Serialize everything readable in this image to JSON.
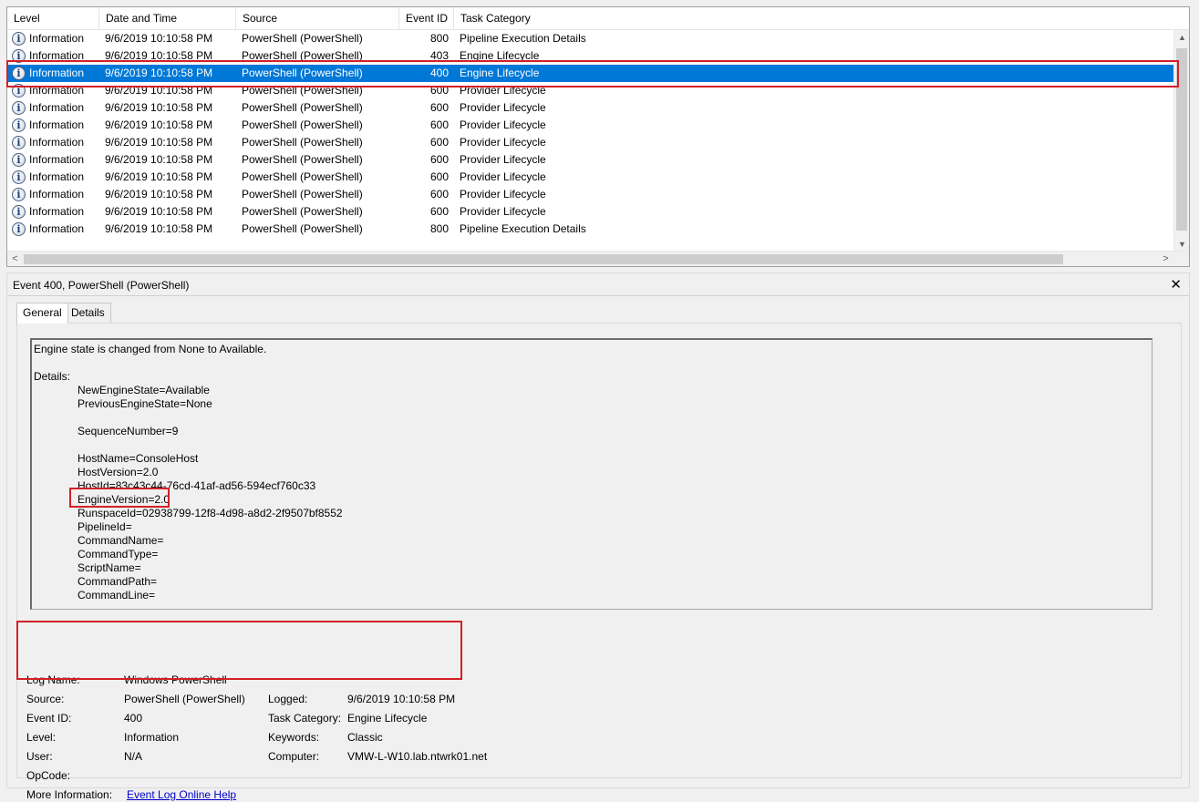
{
  "columns": {
    "level": "Level",
    "date": "Date and Time",
    "source": "Source",
    "event_id": "Event ID",
    "task_category": "Task Category"
  },
  "rows": [
    {
      "level": "Information",
      "date": "9/6/2019 10:10:58 PM",
      "source": "PowerShell (PowerShell)",
      "event_id": "800",
      "category": "Pipeline Execution Details"
    },
    {
      "level": "Information",
      "date": "9/6/2019 10:10:58 PM",
      "source": "PowerShell (PowerShell)",
      "event_id": "403",
      "category": "Engine Lifecycle"
    },
    {
      "level": "Information",
      "date": "9/6/2019 10:10:58 PM",
      "source": "PowerShell (PowerShell)",
      "event_id": "400",
      "category": "Engine Lifecycle",
      "selected": true
    },
    {
      "level": "Information",
      "date": "9/6/2019 10:10:58 PM",
      "source": "PowerShell (PowerShell)",
      "event_id": "600",
      "category": "Provider Lifecycle"
    },
    {
      "level": "Information",
      "date": "9/6/2019 10:10:58 PM",
      "source": "PowerShell (PowerShell)",
      "event_id": "600",
      "category": "Provider Lifecycle"
    },
    {
      "level": "Information",
      "date": "9/6/2019 10:10:58 PM",
      "source": "PowerShell (PowerShell)",
      "event_id": "600",
      "category": "Provider Lifecycle"
    },
    {
      "level": "Information",
      "date": "9/6/2019 10:10:58 PM",
      "source": "PowerShell (PowerShell)",
      "event_id": "600",
      "category": "Provider Lifecycle"
    },
    {
      "level": "Information",
      "date": "9/6/2019 10:10:58 PM",
      "source": "PowerShell (PowerShell)",
      "event_id": "600",
      "category": "Provider Lifecycle"
    },
    {
      "level": "Information",
      "date": "9/6/2019 10:10:58 PM",
      "source": "PowerShell (PowerShell)",
      "event_id": "600",
      "category": "Provider Lifecycle"
    },
    {
      "level": "Information",
      "date": "9/6/2019 10:10:58 PM",
      "source": "PowerShell (PowerShell)",
      "event_id": "600",
      "category": "Provider Lifecycle"
    },
    {
      "level": "Information",
      "date": "9/6/2019 10:10:58 PM",
      "source": "PowerShell (PowerShell)",
      "event_id": "600",
      "category": "Provider Lifecycle"
    },
    {
      "level": "Information",
      "date": "9/6/2019 10:10:58 PM",
      "source": "PowerShell (PowerShell)",
      "event_id": "800",
      "category": "Pipeline Execution Details"
    }
  ],
  "detail": {
    "title": "Event 400, PowerShell (PowerShell)",
    "close_glyph": "✕",
    "tabs": [
      "General",
      "Details"
    ],
    "message": "Engine state is changed from None to Available.",
    "details_label": "Details:",
    "details": [
      "NewEngineState=Available",
      "PreviousEngineState=None",
      "",
      "SequenceNumber=9",
      "",
      "HostName=ConsoleHost",
      "HostVersion=2.0",
      "HostId=83c43c44-76cd-41af-ad56-594ecf760c33",
      "EngineVersion=2.0",
      "RunspaceId=02938799-12f8-4d98-a8d2-2f9507bf8552",
      "PipelineId=",
      "CommandName=",
      "CommandType=",
      "ScriptName=",
      "CommandPath=",
      "CommandLine="
    ],
    "props": {
      "log_name_label": "Log Name:",
      "log_name": "Windows PowerShell",
      "source_label": "Source:",
      "source": "PowerShell (PowerShell)",
      "logged_label": "Logged:",
      "logged": "9/6/2019 10:10:58 PM",
      "event_id_label": "Event ID:",
      "event_id": "400",
      "task_category_label": "Task Category:",
      "task_category": "Engine Lifecycle",
      "level_label": "Level:",
      "level": "Information",
      "keywords_label": "Keywords:",
      "keywords": "Classic",
      "user_label": "User:",
      "user": "N/A",
      "computer_label": "Computer:",
      "computer": "VMW-L-W10.lab.ntwrk01.net",
      "opcode_label": "OpCode:",
      "more_info_label": "More Information:",
      "more_info_link": "Event Log Online Help"
    }
  },
  "icons": {
    "info": "i",
    "scroll_up": "▲",
    "scroll_down": "▼",
    "scroll_left": "<",
    "scroll_right": ">"
  },
  "colors": {
    "selection": "#0078d7",
    "highlight": "#d32027",
    "link": "#0000cc"
  }
}
